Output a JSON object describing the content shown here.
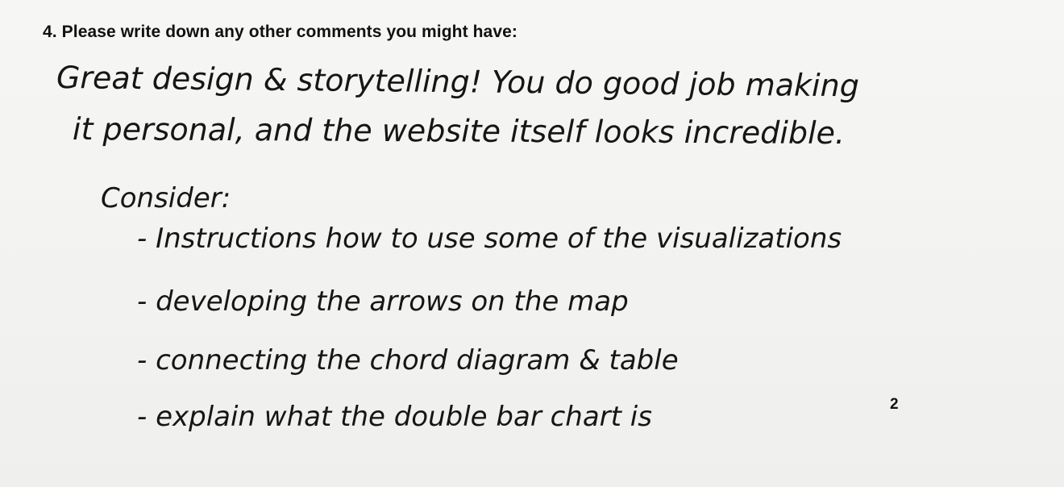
{
  "question": {
    "text": "4. Please write down any other comments you might have:"
  },
  "comment": {
    "line1": "Great design & storytelling! You do good job making",
    "line2": "it personal, and the website itself looks incredible.",
    "consider_heading": "Consider:",
    "items": [
      "- Instructions how to use some of the visualizations",
      "- developing the arrows on the map",
      "- connecting the chord diagram & table",
      "- explain what the double bar chart is"
    ]
  },
  "page_number": "2"
}
